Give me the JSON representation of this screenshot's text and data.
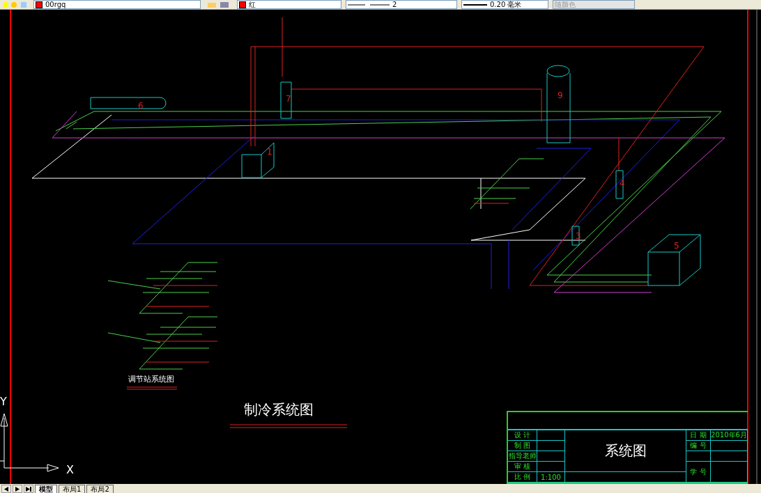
{
  "toolbar": {
    "layer": {
      "value": "00rgq"
    },
    "color": {
      "value": "红"
    },
    "linetype": {
      "value": "2"
    },
    "lineweight": {
      "value": "0.20 毫米"
    },
    "plot_style": {
      "value": "随颜色",
      "disabled": true
    }
  },
  "drawing": {
    "equipment_labels": [
      "1",
      "3",
      "4",
      "5",
      "6",
      "7",
      "9"
    ],
    "subtitle": "调节站系统图",
    "title": "制冷系统图"
  },
  "ucs": {
    "y_label": "Y",
    "x_label": "X"
  },
  "title_block": {
    "left_rows": [
      {
        "label": "设 计",
        "value": ""
      },
      {
        "label": "制 图",
        "value": ""
      },
      {
        "label": "指导老师",
        "value": ""
      },
      {
        "label": "审 核",
        "value": ""
      },
      {
        "label": "比 例",
        "value": "1:100"
      }
    ],
    "name": "系统图",
    "right_rows": [
      {
        "label": "日 期",
        "value": "2010年6月"
      },
      {
        "label": "编 号",
        "value": ""
      },
      {
        "label": "",
        "value": ""
      },
      {
        "label": "学 号",
        "value": ""
      }
    ]
  },
  "layout_tabs": [
    {
      "label": "模型",
      "selected": true
    },
    {
      "label": "布局1",
      "selected": false
    },
    {
      "label": "布局2",
      "selected": false
    }
  ]
}
